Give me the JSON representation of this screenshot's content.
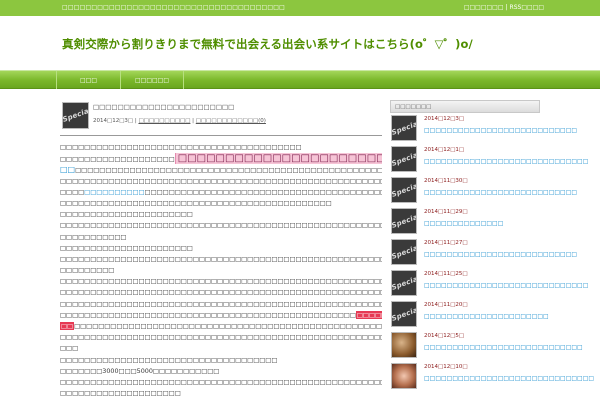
{
  "topbar": {
    "tagline": "□□□□□□□□□□□□□□□□□□□□□□□□□□□□□□□□□□□□□□",
    "link1": "□□□□□□□",
    "separator": "|",
    "link2": "RSS□□□□"
  },
  "site": {
    "title": "真剣交際から割りきりまで無料で出会える出会い系サイトはこちら(o゜▽゜)o/"
  },
  "nav": {
    "home": "□□□",
    "category": "□□□□□□"
  },
  "post": {
    "title": "□□□□□□□□□□□□□□□□□□□□□□□",
    "date": "2014□12□3□",
    "sep": "|",
    "category": "□□□□□□□□□□",
    "comments": "□□□□□□□□□□□□(0)",
    "body_lines": [
      {
        "parts": [
          {
            "t": "□□□□□□□□□□□□□□□□□□□□□□□□□□□□□□□□□□□□□□□□"
          }
        ]
      },
      {
        "parts": [
          {
            "t": "□□□□□□□□□□□□□□□□□□□"
          },
          {
            "t": "□□□□□□□□□□□□□□□□□□□□□□□□□□□□□□□",
            "c": "hl-pink"
          },
          {
            "t": " □□□□□□□□□",
            "c": "big-link"
          }
        ]
      },
      {
        "parts": [
          {
            "t": "□□",
            "c": "big-link"
          },
          {
            "t": "□□□□□□□□□□□□□□□□□□□□□□□□□□□□□□□□□□□□□□□□□□□□□□□□□□□□□□□□□□□□□□□□□□"
          }
        ]
      },
      {
        "parts": [
          {
            "t": "□□□□□□□□□□□□□□□□□□□□□□□□□□□□□□□□□□□□□□□□□□□□□□□□□□□□□□□□□□"
          }
        ]
      },
      {
        "parts": [
          {
            "t": "□□□□"
          },
          {
            "t": "□□□□□□□□□□",
            "c": "link"
          },
          {
            "t": "□□□□□□□□□□□□□□□□□□□□□□□□□□□□□□□□□□□□□□□□□□□□□□□□□□□□□□□□□□□□□□□□□□□□□□□"
          }
        ]
      },
      {
        "parts": [
          {
            "t": "□□□□□□□□□□□□□□□□□□□□□□□□□□□□□□□□□□□□□□□□□□□□□"
          }
        ]
      },
      {
        "parts": [
          {
            "t": "□□□□□□□□□□□□□□□□□□□□□□"
          }
        ]
      },
      {
        "parts": [
          {
            "t": "□□□□□□□□□□□□□□□□□□□□□□□□□□□□□□□□□□□□□□□□□□□□□□□□□□□□□□□□□□□□□□□□□□□□□□□□□□□□□□□□□□□□□□"
          }
        ]
      },
      {
        "parts": [
          {
            "t": "□□□□□□□□□□□"
          }
        ]
      },
      {
        "parts": [
          {
            "t": "□□□□□□□□□□□□□□□□□□□□□□"
          }
        ]
      },
      {
        "parts": [
          {
            "t": "□□□□□□□□□□□□□□□□□□□□□□□□□□□□□□□□□□□□□□□□□□□□□□□□□□□□□□□□□□□□□□□□□□□□□□□□"
          }
        ]
      },
      {
        "parts": [
          {
            "t": "□□□□□□□□□"
          }
        ]
      },
      {
        "parts": [
          {
            "t": "□□□□□□□□□□□□□□□□□□□□□□□□□□□□□□□□□□□□□□□□□□□□□□□□□□□□□□□□□□□□□□□□□□□□□□□□□□□□□□□□□□□□□□"
          }
        ]
      },
      {
        "parts": [
          {
            "t": "□□□□□□□□□□□□□□□□□□□□□□□□□□□□□□□□□□□□□□□□□□□□□□□□□□□□□□□□□□□□□□□□□□□□□□□□□□□□□□□□□□□□□□"
          }
        ]
      },
      {
        "parts": [
          {
            "t": "□□□□□□□□□□□□□□□□□□□□□□□□□□□□□□□□□□□□□□□□□□□□□□□□□□□□□□□□□□□□□□□□"
          }
        ]
      },
      {
        "parts": [
          {
            "t": "□□□□□□□□□□□□□□□□□□□□□□□□□□□□□□□□□□□□□□□□□□□□□□□□□"
          },
          {
            "t": "□□□□□□□□□□□□□□□□□□□□□□□□□",
            "c": "hl-red"
          }
        ]
      },
      {
        "parts": [
          {
            "t": "□□",
            "c": "hl-red"
          },
          {
            "t": "□□□□□□□□□□□□□□□□□□□□□□□□□□□□□□□□□□□□□□□□□□□□□□□□□□□□□□□□□□□□□□□□□□□□□□□□□□□□□□□□□□□□"
          }
        ]
      },
      {
        "parts": [
          {
            "t": "□□□□□□□□□□□□□□□□□□□□□□□□□□□□□□□□□□□□□□□□□□□□□□□□□□□□□□□□□□□□□□□□□□□□□□□□□□□□□□□□□□□□□□"
          }
        ]
      },
      {
        "parts": [
          {
            "t": "□□□"
          }
        ]
      },
      {
        "parts": [
          {
            "t": "□□□□□□□□□□□□□□□□□□□□□□□□□□□□□□□□□□□□"
          }
        ]
      },
      {
        "parts": [
          {
            "t": "□□□□□□□3000□□□5000□□□□□□□□□□□"
          }
        ]
      },
      {
        "parts": [
          {
            "t": "□□□□□□□□□□□□□□□□□□□□□□□□□□□□□□□□□□□□□□□□□□□□□□□□□□□□□□□□□□□□□"
          }
        ]
      },
      {
        "parts": [
          {
            "t": "□□□□□□□□□□□□□□□□□□□□"
          }
        ]
      },
      {
        "parts": [
          {
            "t": "□□□"
          },
          {
            "t": "□□□□□□□□□□□□□□□□",
            "c": "hl-purple"
          },
          {
            "t": "□□□□□□□□□□□□□□□□□□□□□□□□□□□□□□□□□□□□□□□□□□□□□□□□□□□□□□□□□□□□□□□□"
          }
        ]
      }
    ]
  },
  "sidebar": {
    "heading": "□□□□□□□",
    "thumb_label": "Special",
    "items": [
      {
        "date": "2014□12□3□",
        "title": "□□□□□□□□□□□□□□□□□□□□□□□□□□□",
        "thumb": "special"
      },
      {
        "date": "2014□12□1□",
        "title": "□□□□□□□□□□□□□□□□□□□□□□□□□□□□□",
        "thumb": "special"
      },
      {
        "date": "2014□11□30□",
        "title": "□□□□□□□□□□□□□□□□□□□□□□□□□□□",
        "thumb": "special"
      },
      {
        "date": "2014□11□29□",
        "title": "□□□□□□□□□□□□□□",
        "thumb": "special"
      },
      {
        "date": "2014□11□27□",
        "title": "□□□□□□□□□□□□□□□□□□□□□□□□□□□",
        "thumb": "special"
      },
      {
        "date": "2014□11□25□",
        "title": "□□□□□□□□□□□□□□□□□□□□□□□□□□□□□",
        "thumb": "special"
      },
      {
        "date": "2014□11□20□",
        "title": "□□□□□□□□□□□□□□□□□□□□□□",
        "thumb": "special"
      },
      {
        "date": "2014□12□5□",
        "title": "□□□□□□□□□□□□□□□□□□□□□□□□□□□□",
        "thumb": "photo1"
      },
      {
        "date": "2014□12□10□",
        "title": "□□□□□□□□□□□□□□□□□□□□□□□□□□□□□□",
        "thumb": "photo2"
      }
    ]
  },
  "colors": {
    "brand_green": "#8cc63f",
    "title_green": "#4f8e00",
    "link_blue": "#1e90cf",
    "highlight_pink": "#f6c4d6",
    "highlight_red": "#e63a54",
    "highlight_purple": "#b24aa6",
    "date_red": "#8b1a1a"
  }
}
